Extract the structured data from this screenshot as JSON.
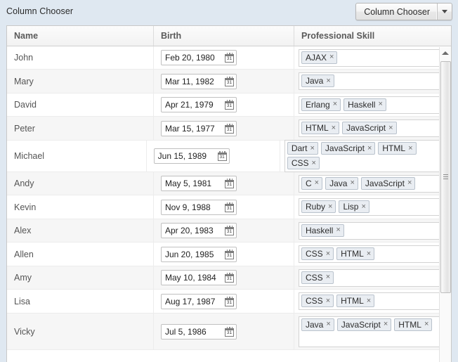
{
  "toolbar": {
    "title": "Column Chooser",
    "button_label": "Column Chooser",
    "dropdown_icon": "chevron-down-icon"
  },
  "grid": {
    "columns": [
      {
        "key": "name",
        "label": "Name"
      },
      {
        "key": "birth",
        "label": "Birth"
      },
      {
        "key": "skill",
        "label": "Professional Skill"
      }
    ],
    "rows": [
      {
        "name": "John",
        "birth": "Feb 20, 1980",
        "skills": [
          "AJAX"
        ]
      },
      {
        "name": "Mary",
        "birth": "Mar 11, 1982",
        "skills": [
          "Java"
        ]
      },
      {
        "name": "David",
        "birth": "Apr 21, 1979",
        "skills": [
          "Erlang",
          "Haskell"
        ]
      },
      {
        "name": "Peter",
        "birth": "Mar 15, 1977",
        "skills": [
          "HTML",
          "JavaScript"
        ]
      },
      {
        "name": "Michael",
        "birth": "Jun 15, 1989",
        "skills": [
          "Dart",
          "JavaScript",
          "HTML",
          "CSS"
        ]
      },
      {
        "name": "Andy",
        "birth": "May 5, 1981",
        "skills": [
          "C",
          "Java",
          "JavaScript"
        ]
      },
      {
        "name": "Kevin",
        "birth": "Nov 9, 1988",
        "skills": [
          "Ruby",
          "Lisp"
        ]
      },
      {
        "name": "Alex",
        "birth": "Apr 20, 1983",
        "skills": [
          "Haskell"
        ]
      },
      {
        "name": "Allen",
        "birth": "Jun 20, 1985",
        "skills": [
          "CSS",
          "HTML"
        ]
      },
      {
        "name": "Amy",
        "birth": "May 10, 1984",
        "skills": [
          "CSS"
        ]
      },
      {
        "name": "Lisa",
        "birth": "Aug 17, 1987",
        "skills": [
          "CSS",
          "HTML"
        ]
      },
      {
        "name": "Vicky",
        "birth": "Jul 5, 1986",
        "skills": [
          "Java",
          "JavaScript",
          "HTML"
        ]
      }
    ],
    "date_picker_icon": "calendar-icon",
    "calendar_day_label": "31",
    "tag_remove_icon": "close-icon",
    "tag_remove_glyph": "×"
  },
  "scrollbar": {
    "up_arrow_icon": "caret-up-icon",
    "grip_icon": "grip-lines-icon"
  },
  "colors": {
    "page_background": "#dfe8f1",
    "grid_background": "#ffffff",
    "row_alt_background": "#f6f6f6",
    "header_text": "#5a5a5a",
    "tag_background": "#e9edf2",
    "tag_border": "#b9c2cc"
  }
}
